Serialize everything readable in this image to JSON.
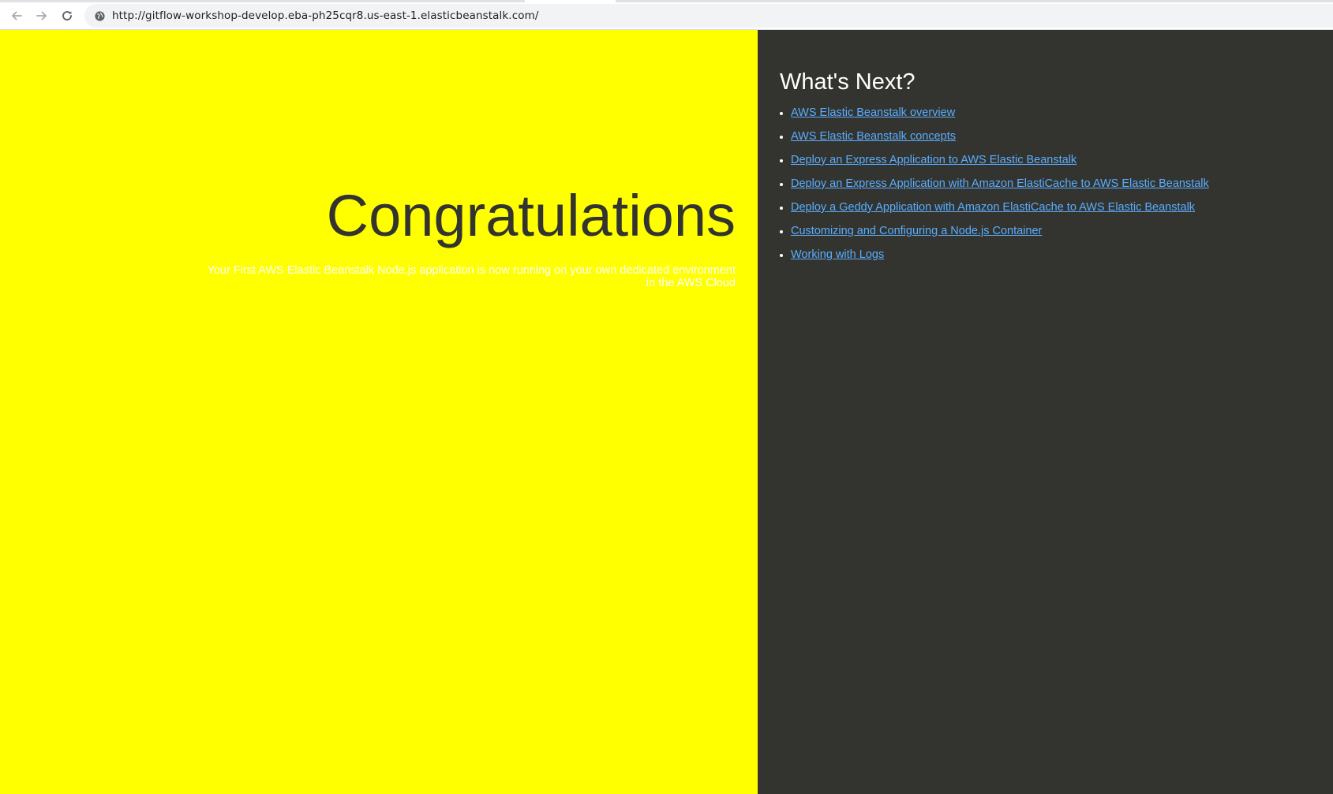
{
  "browser": {
    "url": "http://gitflow-workshop-develop.eba-ph25cqr8.us-east-1.elasticbeanstalk.com/",
    "icons": {
      "back": "back-arrow-icon",
      "forward": "forward-arrow-icon",
      "reload": "reload-icon",
      "site_info": "site-info-icon"
    }
  },
  "hero": {
    "title": "Congratulations",
    "text": "Your First AWS Elastic Beanstalk Node.js application is now running on your own dedicated environment in the AWS Cloud"
  },
  "next": {
    "title": "What's Next?",
    "links": [
      {
        "label": "AWS Elastic Beanstalk overview"
      },
      {
        "label": "AWS Elastic Beanstalk concepts"
      },
      {
        "label": "Deploy an Express Application to AWS Elastic Beanstalk"
      },
      {
        "label": "Deploy an Express Application with Amazon ElastiCache to AWS Elastic Beanstalk"
      },
      {
        "label": "Deploy a Geddy Application with Amazon ElastiCache to AWS Elastic Beanstalk"
      },
      {
        "label": "Customizing and Configuring a Node.js Container"
      },
      {
        "label": "Working with Logs"
      }
    ]
  },
  "colors": {
    "left_background": "#ffff00",
    "right_background": "#33342f",
    "title_text": "#33342f",
    "link": "#5aadff"
  }
}
